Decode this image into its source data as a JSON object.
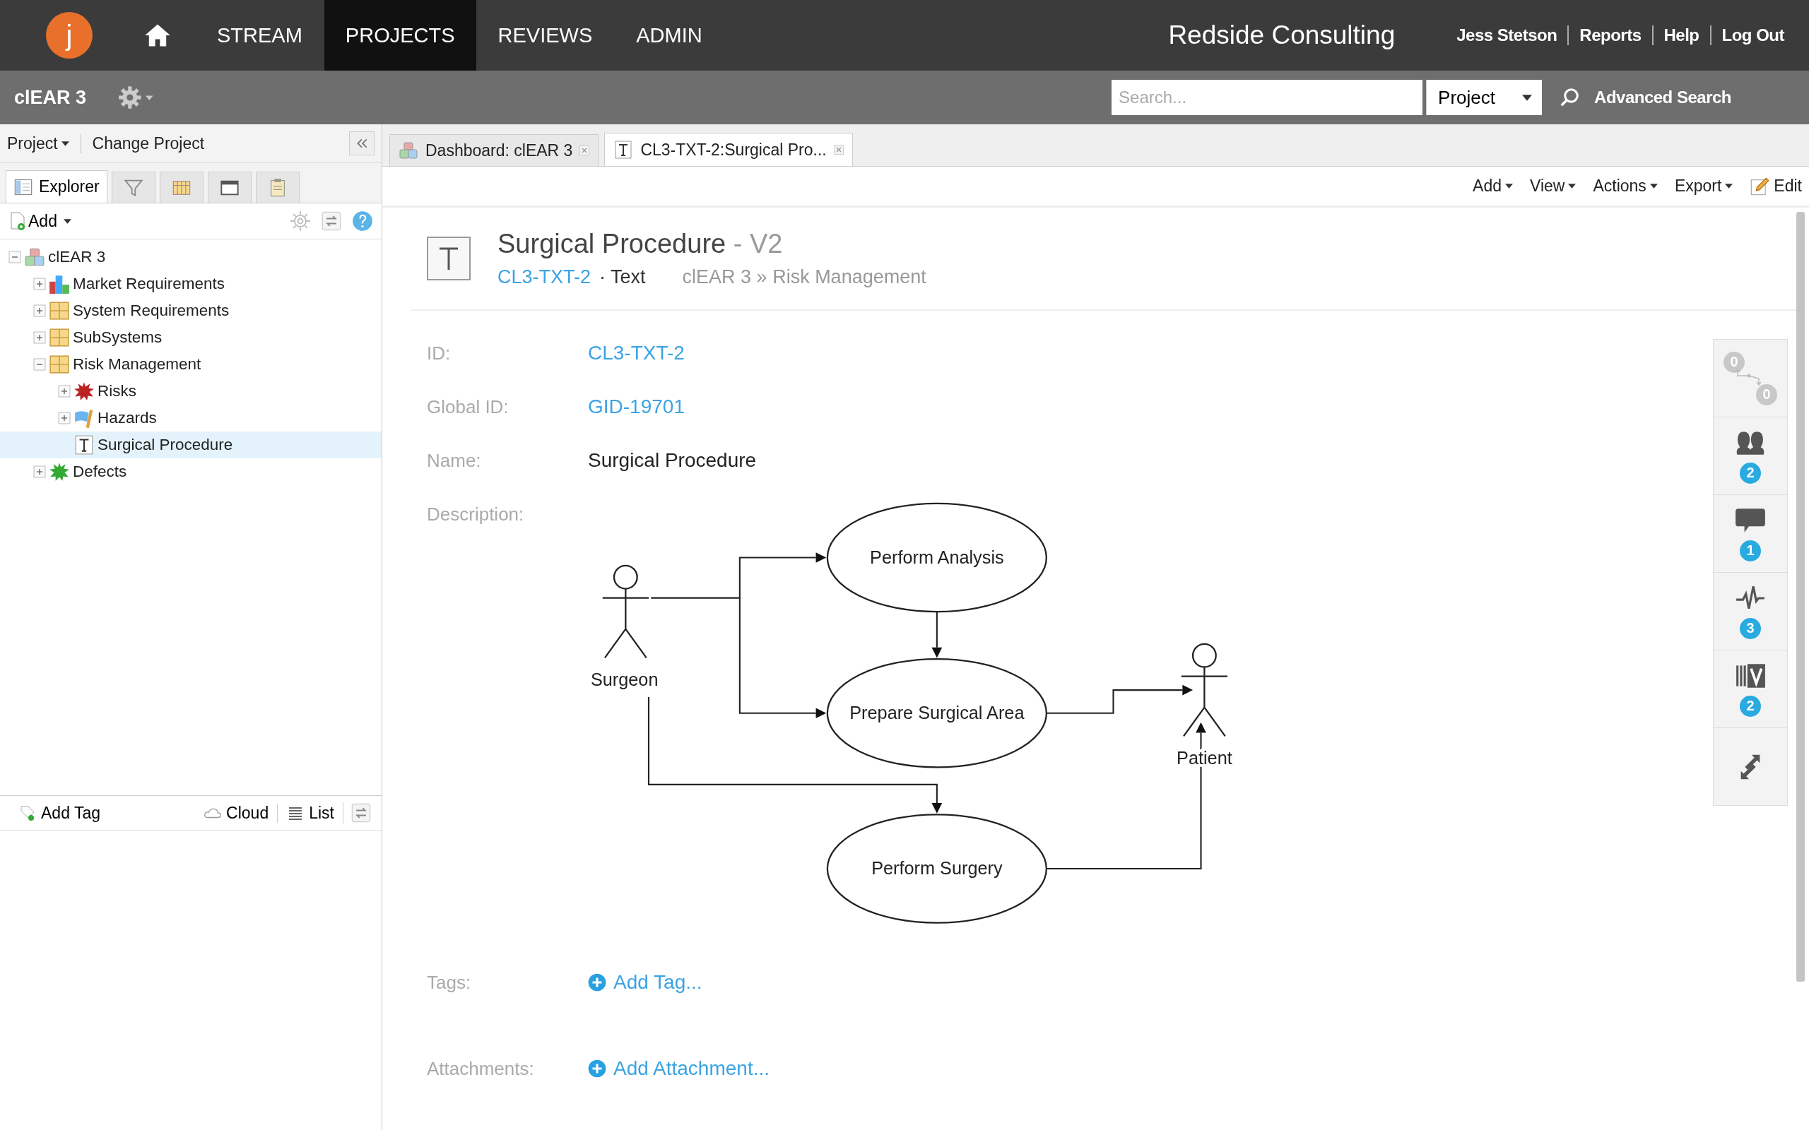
{
  "nav": {
    "logo": "j",
    "items": [
      {
        "label": "STREAM",
        "selected": false
      },
      {
        "label": "PROJECTS",
        "selected": true
      },
      {
        "label": "REVIEWS",
        "selected": false
      },
      {
        "label": "ADMIN",
        "selected": false
      }
    ]
  },
  "company": "Redside Consulting",
  "user_links": [
    "Jess Stetson",
    "Reports",
    "Help",
    "Log Out"
  ],
  "project_bar": {
    "title": "clEAR 3",
    "search": {
      "placeholder": "Search...",
      "scope": "Project"
    },
    "advanced_search": "Advanced Search"
  },
  "left_panel": {
    "menu": [
      "Project",
      "Change Project"
    ],
    "tabs": [
      {
        "kind": "explorer",
        "label": "Explorer",
        "selected": true
      },
      {
        "kind": "filter",
        "selected": false
      },
      {
        "kind": "calendar",
        "selected": false
      },
      {
        "kind": "window",
        "selected": false
      },
      {
        "kind": "clipboard",
        "selected": false
      }
    ],
    "add": "Add",
    "tree": [
      {
        "label": "clEAR 3",
        "kind": "project",
        "expanded": true,
        "selected": false,
        "children": [
          {
            "label": "Market Requirements",
            "kind": "chart",
            "expanded": false,
            "selected": false
          },
          {
            "label": "System Requirements",
            "kind": "folder",
            "expanded": false,
            "selected": false
          },
          {
            "label": "SubSystems",
            "kind": "folder",
            "expanded": false,
            "selected": false
          },
          {
            "label": "Risk Management",
            "kind": "folder",
            "expanded": true,
            "selected": false,
            "children": [
              {
                "label": "Risks",
                "kind": "risk",
                "expanded": false,
                "selected": false
              },
              {
                "label": "Hazards",
                "kind": "hazard",
                "expanded": false,
                "selected": false
              },
              {
                "label": "Surgical Procedure",
                "kind": "text",
                "selected": true
              }
            ]
          },
          {
            "label": "Defects",
            "kind": "defect",
            "expanded": false,
            "selected": false
          }
        ]
      }
    ],
    "tag_bar": {
      "add": "Add Tag",
      "cloud": "Cloud",
      "list": "List"
    }
  },
  "doc_tabs": [
    {
      "label": "Dashboard: clEAR 3",
      "kind": "dashboard",
      "selected": false
    },
    {
      "label": "CL3-TXT-2:Surgical Pro...",
      "kind": "text",
      "selected": true
    }
  ],
  "toolbar": [
    {
      "label": "Add",
      "kind": "menu"
    },
    {
      "label": "View",
      "kind": "menu"
    },
    {
      "label": "Actions",
      "kind": "menu"
    },
    {
      "label": "Export",
      "kind": "menu"
    },
    {
      "label": "Edit",
      "kind": "edit"
    }
  ],
  "item": {
    "title": "Surgical Procedure",
    "version": "- V2",
    "id": "CL3-TXT-2",
    "type": "· Text",
    "path": "clEAR 3 » Risk Management"
  },
  "fields": [
    {
      "label": "ID:",
      "kind": "link",
      "value": "CL3-TXT-2"
    },
    {
      "label": "Global ID:",
      "kind": "link",
      "value": "GID-19701"
    },
    {
      "label": "Name:",
      "kind": "text",
      "value": "Surgical Procedure"
    },
    {
      "label": "Description:",
      "kind": "diagram"
    },
    {
      "label": "Tags:",
      "kind": "add",
      "value": "Add Tag..."
    },
    {
      "label": "Attachments:",
      "kind": "add",
      "value": "Add Attachment..."
    }
  ],
  "diagram": {
    "nodes": [
      {
        "kind": "actor",
        "label": "Surgeon"
      },
      {
        "kind": "actor",
        "label": "Patient"
      },
      {
        "kind": "usecase",
        "label": "Perform Analysis"
      },
      {
        "kind": "usecase",
        "label": "Prepare Surgical Area"
      },
      {
        "kind": "usecase",
        "label": "Perform Surgery"
      }
    ]
  },
  "widgets": [
    {
      "kind": "relations",
      "counts": [
        "0",
        "0"
      ]
    },
    {
      "kind": "people",
      "count": "2"
    },
    {
      "kind": "comments",
      "count": "1"
    },
    {
      "kind": "activity",
      "count": "3"
    },
    {
      "kind": "versions",
      "count": "2"
    },
    {
      "kind": "sync"
    }
  ]
}
